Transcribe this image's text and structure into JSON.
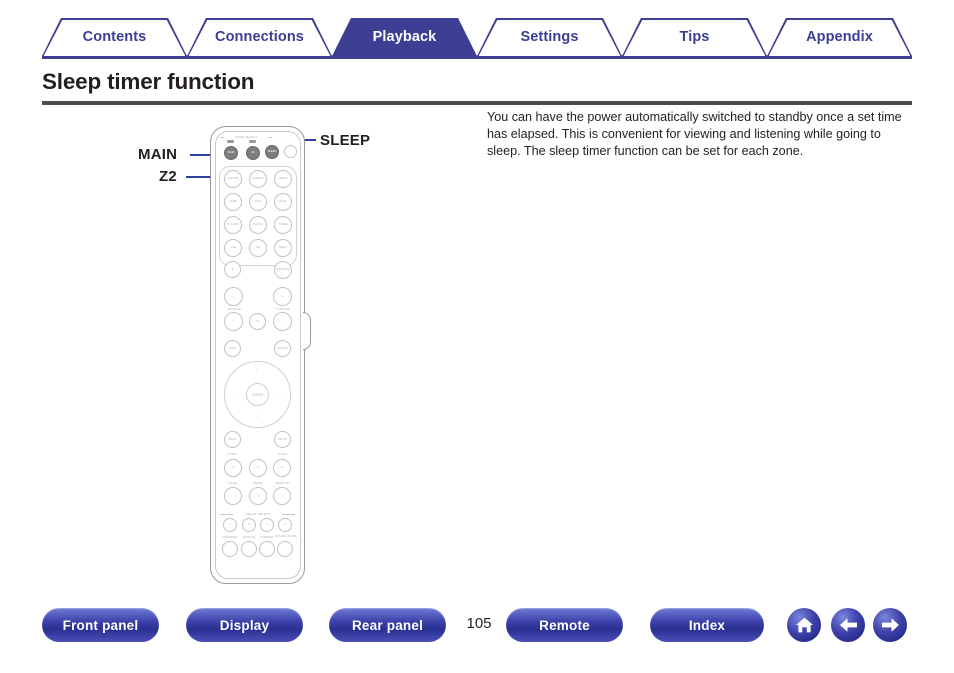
{
  "nav_tabs": [
    {
      "label": "Contents",
      "active": false
    },
    {
      "label": "Connections",
      "active": false
    },
    {
      "label": "Playback",
      "active": true
    },
    {
      "label": "Settings",
      "active": false
    },
    {
      "label": "Tips",
      "active": false
    },
    {
      "label": "Appendix",
      "active": false
    }
  ],
  "page": {
    "title": "Sleep timer function",
    "body": "You can have the power automatically switched to standby once a set time has elapsed. This is convenient for viewing and listening while going to sleep. The sleep timer function can be set for each zone.",
    "number": "105"
  },
  "callouts": {
    "main": "MAIN",
    "z2": "Z2",
    "sleep": "SLEEP"
  },
  "remote": {
    "zone_select_label": "ZONE SELECT",
    "smart_select_label": "SMART SELECT",
    "buttons": {
      "main": "MAIN",
      "z2": "Z2",
      "sleep": "SLEEP",
      "power": "",
      "sat_cbl": "SAT/CBL",
      "dvd_blu": "DVD/BLU",
      "media": "MEDIA",
      "game": "GAME",
      "aux1": "AUX1",
      "aux2": "AUX2",
      "tv_audio": "TV AUDIO",
      "phono": "PHONO",
      "tuner": "TUNER",
      "usb": "USB",
      "cd": "CD",
      "heos": "HEOS",
      "mic": "MIC",
      "disc_skip": "DISC SKIP",
      "mute": "MUTE",
      "info": "INFO",
      "option": "OPTION",
      "enter": "ENTER",
      "back": "BACK",
      "setup": "SETUP",
      "tune_minus": "TUNE -",
      "tune_plus": "TUNE +",
      "prev": "PREV",
      "play_pause": "PLAY/PAUSE",
      "next": "NEXT",
      "band": "BAND",
      "mode": "MODE",
      "memory": "MEMORY",
      "stop": "STOP",
      "smart1": "1",
      "smart2": "2",
      "smart3": "3",
      "smart4": "4",
      "speaker": "SPEAKER",
      "status": "STATUS",
      "dimmer": "DIMMER",
      "sound_mode": "SOUND MODE"
    },
    "groups": {
      "ch_page": "CH/PAGE",
      "volume": "VOLUME"
    }
  },
  "footer": {
    "buttons": [
      {
        "label": "Front panel"
      },
      {
        "label": "Display"
      },
      {
        "label": "Rear panel"
      },
      {
        "label": "Remote"
      },
      {
        "label": "Index"
      }
    ],
    "icons": [
      {
        "name": "home-icon"
      },
      {
        "name": "arrow-left-icon"
      },
      {
        "name": "arrow-right-icon"
      }
    ]
  },
  "colors": {
    "brand_blue": "#3c3f93",
    "leader_blue": "#2b3f9e",
    "rule_gray": "#4d4d4d",
    "text_dark": "#231f20"
  }
}
